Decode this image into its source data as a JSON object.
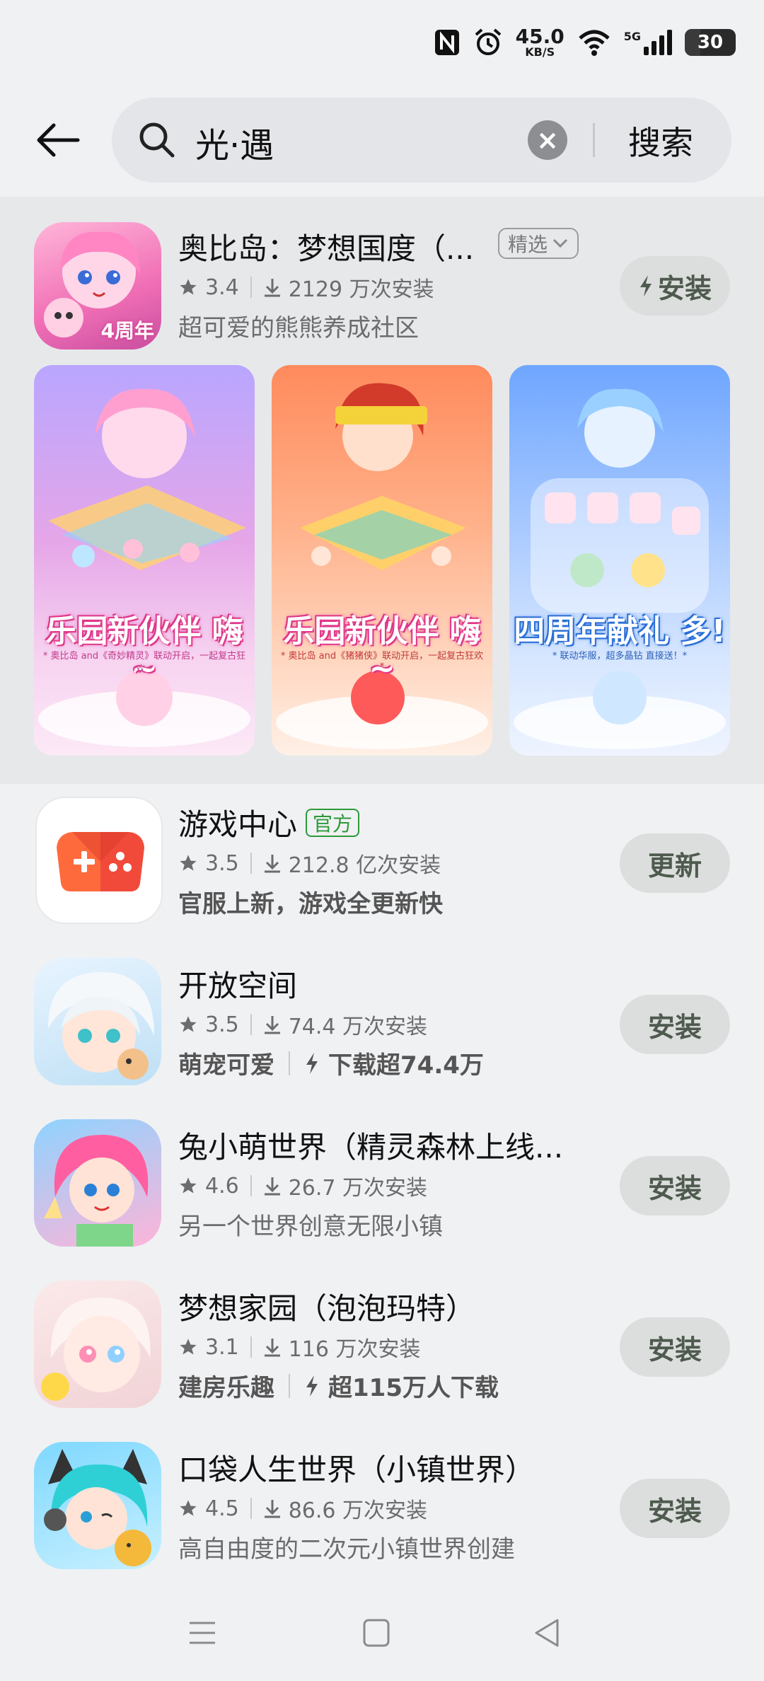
{
  "status_bar": {
    "nfc_icon": "nfc-icon",
    "alarm_icon": "alarm-icon",
    "net_speed": "45.0",
    "net_speed_unit": "KB/S",
    "wifi_icon": "wifi-icon",
    "network_type": "5G",
    "battery": "30",
    "battery_level": 0.3
  },
  "search": {
    "query": "光·遇",
    "clear_icon": "clear-icon",
    "button_label": "搜索"
  },
  "featured": {
    "name": "奥比岛：梦想国度（...",
    "tag": "精选",
    "rating": "3.4",
    "installs": "2129 万次安装",
    "description": "超可爱的熊熊养成社区",
    "button": "安装",
    "icon_badge": "4周年",
    "screenshots": [
      {
        "title": "乐园新伙伴 嗨~",
        "caption": "* 奥比岛 and《奇妙精灵》联动开启，一起复古狂欢 *"
      },
      {
        "title": "乐园新伙伴 嗨~",
        "caption": "* 奥比岛 and《猪猪侠》联动开启，一起复古狂欢 *"
      },
      {
        "title": "四周年献礼 多!",
        "caption": "* 联动华服，超多晶钻 直接送！*"
      }
    ]
  },
  "apps": [
    {
      "name": "游戏中心",
      "badge": "官方",
      "rating": "3.5",
      "installs": "212.8 亿次安装",
      "desc": "官服上新，游戏全更新快",
      "desc_extra": "",
      "button": "更新"
    },
    {
      "name": "开放空间",
      "badge": "",
      "rating": "3.5",
      "installs": "74.4 万次安装",
      "desc": "萌宠可爱",
      "desc_extra": "下载超74.4万",
      "button": "安装"
    },
    {
      "name": "兔小萌世界（精灵森林上线...",
      "badge": "",
      "rating": "4.6",
      "installs": "26.7 万次安装",
      "desc": "另一个世界创意无限小镇",
      "desc_extra": "",
      "button": "安装"
    },
    {
      "name": "梦想家园（泡泡玛特）",
      "badge": "",
      "rating": "3.1",
      "installs": "116 万次安装",
      "desc": "建房乐趣",
      "desc_extra": "超115万人下载",
      "button": "安装"
    },
    {
      "name": "口袋人生世界（小镇世界）",
      "badge": "",
      "rating": "4.5",
      "installs": "86.6 万次安装",
      "desc": "高自由度的二次元小镇世界创建",
      "desc_extra": "",
      "button": "安装"
    }
  ],
  "colors": {
    "background": "#f0f1f3",
    "button_bg": "#dcdedd",
    "button_text": "#4e5a4e",
    "official_badge": "#2c9a3a"
  }
}
